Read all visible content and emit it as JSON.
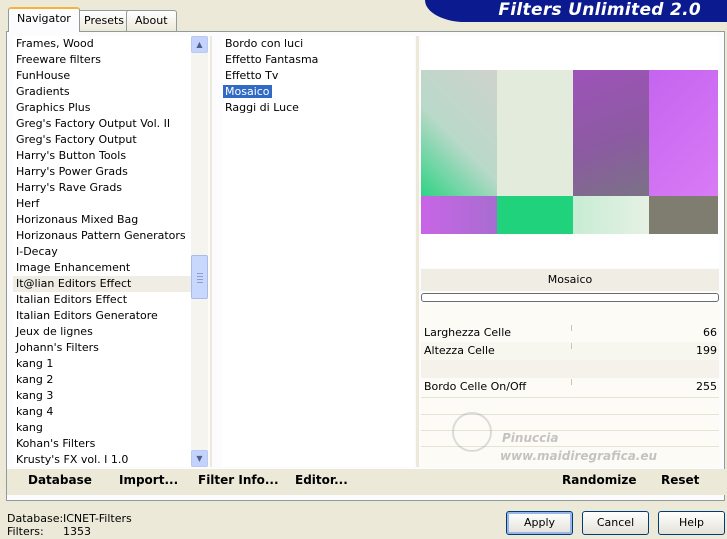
{
  "tabs": [
    "Navigator",
    "Presets",
    "About"
  ],
  "banner_title": "Filters Unlimited 2.0",
  "categories": [
    "Frames, Wood",
    "Freeware filters",
    "FunHouse",
    "Gradients",
    "Graphics Plus",
    "Greg's Factory Output Vol. II",
    "Greg's Factory Output",
    "Harry's Button Tools",
    "Harry's Power Grads",
    "Harry's Rave Grads",
    "Herf",
    "Horizonaus Mixed Bag",
    "Horizonaus Pattern Generators",
    "I-Decay",
    "Image Enhancement",
    "It@lian Editors Effect",
    "Italian Editors Effect",
    "Italian Editors Generatore",
    "Jeux de lignes",
    "Johann's Filters",
    "kang 1",
    "kang 2",
    "kang 3",
    "kang 4",
    "kang",
    "Kohan's Filters",
    "Krusty's FX vol. I 1.0"
  ],
  "highlighted_category_index": 15,
  "filters": [
    "Bordo con luci",
    "Effetto Fantasma",
    "Effetto Tv",
    "Mosaico",
    "Raggi di Luce"
  ],
  "selected_filter_index": 3,
  "filter_name": "Mosaico",
  "params": [
    {
      "label": "Larghezza Celle",
      "value": "66"
    },
    {
      "label": "Altezza Celle",
      "value": "199"
    },
    {
      "label": "Bordo Celle On/Off",
      "value": "255"
    }
  ],
  "toolbar": {
    "database": "Database",
    "import": "Import...",
    "filter_info": "Filter Info...",
    "editor": "Editor...",
    "randomize": "Randomize",
    "reset": "Reset"
  },
  "status": {
    "database_label": "Database:",
    "database_value": "ICNET-Filters",
    "filters_label": "Filters:",
    "filters_value": "1353"
  },
  "buttons": {
    "apply": "Apply",
    "cancel": "Cancel",
    "help": "Help"
  },
  "watermark": {
    "line1": "Pinuccia",
    "line2": "www.maidiregrafica.eu"
  },
  "colors": {
    "banner": "#0b1a8e",
    "selection": "#316ac5"
  }
}
